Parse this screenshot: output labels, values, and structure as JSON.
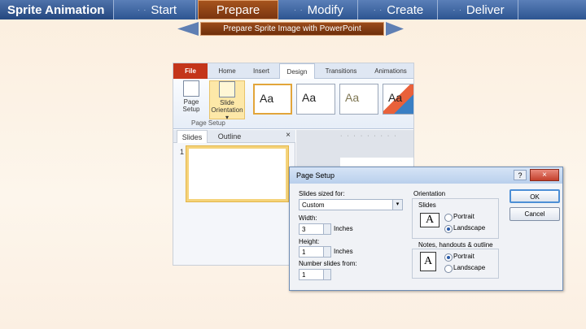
{
  "header": {
    "brand": "Sprite Animation",
    "tabs": [
      {
        "label": "Start",
        "active": false
      },
      {
        "label": "Prepare",
        "active": true
      },
      {
        "label": "Modify",
        "active": false
      },
      {
        "label": "Create",
        "active": false
      },
      {
        "label": "Deliver",
        "active": false
      }
    ]
  },
  "subheader": {
    "title": "Prepare Sprite Image with PowerPoint"
  },
  "ppt": {
    "ribbon_tabs": [
      "File",
      "Home",
      "Insert",
      "Design",
      "Transitions",
      "Animations"
    ],
    "page_setup_button": "Page Setup",
    "slide_orientation_button": "Slide Orientation ▾",
    "group_label": "Page Setup",
    "themes": [
      "Aa",
      "Aa",
      "Aa",
      "Aa"
    ],
    "panel_tabs": [
      "Slides",
      "Outline"
    ],
    "panel_close": "×",
    "slide_number": "1"
  },
  "dialog": {
    "title": "Page Setup",
    "help": "?",
    "close": "×",
    "slides_sized_for_label": "Slides sized for:",
    "slides_sized_for_value": "Custom",
    "width_label": "Width:",
    "width_value": "3",
    "width_unit": "Inches",
    "height_label": "Height:",
    "height_value": "1",
    "height_unit": "Inches",
    "number_from_label": "Number slides from:",
    "number_from_value": "1",
    "orientation_label": "Orientation",
    "slides_label": "Slides",
    "slides_portrait": "Portrait",
    "slides_landscape": "Landscape",
    "notes_label": "Notes, handouts & outline",
    "notes_portrait": "Portrait",
    "notes_landscape": "Landscape",
    "ok": "OK",
    "cancel": "Cancel",
    "icon_letter": "A"
  }
}
